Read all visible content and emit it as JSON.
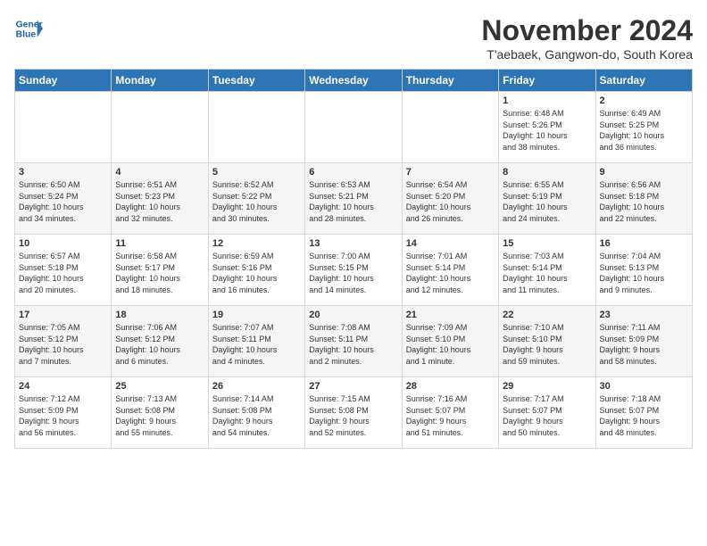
{
  "header": {
    "logo_line1": "General",
    "logo_line2": "Blue",
    "month_title": "November 2024",
    "location": "T'aebaek, Gangwon-do, South Korea"
  },
  "days_of_week": [
    "Sunday",
    "Monday",
    "Tuesday",
    "Wednesday",
    "Thursday",
    "Friday",
    "Saturday"
  ],
  "weeks": [
    [
      {
        "day": "",
        "info": ""
      },
      {
        "day": "",
        "info": ""
      },
      {
        "day": "",
        "info": ""
      },
      {
        "day": "",
        "info": ""
      },
      {
        "day": "",
        "info": ""
      },
      {
        "day": "1",
        "info": "Sunrise: 6:48 AM\nSunset: 5:26 PM\nDaylight: 10 hours\nand 38 minutes."
      },
      {
        "day": "2",
        "info": "Sunrise: 6:49 AM\nSunset: 5:25 PM\nDaylight: 10 hours\nand 36 minutes."
      }
    ],
    [
      {
        "day": "3",
        "info": "Sunrise: 6:50 AM\nSunset: 5:24 PM\nDaylight: 10 hours\nand 34 minutes."
      },
      {
        "day": "4",
        "info": "Sunrise: 6:51 AM\nSunset: 5:23 PM\nDaylight: 10 hours\nand 32 minutes."
      },
      {
        "day": "5",
        "info": "Sunrise: 6:52 AM\nSunset: 5:22 PM\nDaylight: 10 hours\nand 30 minutes."
      },
      {
        "day": "6",
        "info": "Sunrise: 6:53 AM\nSunset: 5:21 PM\nDaylight: 10 hours\nand 28 minutes."
      },
      {
        "day": "7",
        "info": "Sunrise: 6:54 AM\nSunset: 5:20 PM\nDaylight: 10 hours\nand 26 minutes."
      },
      {
        "day": "8",
        "info": "Sunrise: 6:55 AM\nSunset: 5:19 PM\nDaylight: 10 hours\nand 24 minutes."
      },
      {
        "day": "9",
        "info": "Sunrise: 6:56 AM\nSunset: 5:18 PM\nDaylight: 10 hours\nand 22 minutes."
      }
    ],
    [
      {
        "day": "10",
        "info": "Sunrise: 6:57 AM\nSunset: 5:18 PM\nDaylight: 10 hours\nand 20 minutes."
      },
      {
        "day": "11",
        "info": "Sunrise: 6:58 AM\nSunset: 5:17 PM\nDaylight: 10 hours\nand 18 minutes."
      },
      {
        "day": "12",
        "info": "Sunrise: 6:59 AM\nSunset: 5:16 PM\nDaylight: 10 hours\nand 16 minutes."
      },
      {
        "day": "13",
        "info": "Sunrise: 7:00 AM\nSunset: 5:15 PM\nDaylight: 10 hours\nand 14 minutes."
      },
      {
        "day": "14",
        "info": "Sunrise: 7:01 AM\nSunset: 5:14 PM\nDaylight: 10 hours\nand 12 minutes."
      },
      {
        "day": "15",
        "info": "Sunrise: 7:03 AM\nSunset: 5:14 PM\nDaylight: 10 hours\nand 11 minutes."
      },
      {
        "day": "16",
        "info": "Sunrise: 7:04 AM\nSunset: 5:13 PM\nDaylight: 10 hours\nand 9 minutes."
      }
    ],
    [
      {
        "day": "17",
        "info": "Sunrise: 7:05 AM\nSunset: 5:12 PM\nDaylight: 10 hours\nand 7 minutes."
      },
      {
        "day": "18",
        "info": "Sunrise: 7:06 AM\nSunset: 5:12 PM\nDaylight: 10 hours\nand 6 minutes."
      },
      {
        "day": "19",
        "info": "Sunrise: 7:07 AM\nSunset: 5:11 PM\nDaylight: 10 hours\nand 4 minutes."
      },
      {
        "day": "20",
        "info": "Sunrise: 7:08 AM\nSunset: 5:11 PM\nDaylight: 10 hours\nand 2 minutes."
      },
      {
        "day": "21",
        "info": "Sunrise: 7:09 AM\nSunset: 5:10 PM\nDaylight: 10 hours\nand 1 minute."
      },
      {
        "day": "22",
        "info": "Sunrise: 7:10 AM\nSunset: 5:10 PM\nDaylight: 9 hours\nand 59 minutes."
      },
      {
        "day": "23",
        "info": "Sunrise: 7:11 AM\nSunset: 5:09 PM\nDaylight: 9 hours\nand 58 minutes."
      }
    ],
    [
      {
        "day": "24",
        "info": "Sunrise: 7:12 AM\nSunset: 5:09 PM\nDaylight: 9 hours\nand 56 minutes."
      },
      {
        "day": "25",
        "info": "Sunrise: 7:13 AM\nSunset: 5:08 PM\nDaylight: 9 hours\nand 55 minutes."
      },
      {
        "day": "26",
        "info": "Sunrise: 7:14 AM\nSunset: 5:08 PM\nDaylight: 9 hours\nand 54 minutes."
      },
      {
        "day": "27",
        "info": "Sunrise: 7:15 AM\nSunset: 5:08 PM\nDaylight: 9 hours\nand 52 minutes."
      },
      {
        "day": "28",
        "info": "Sunrise: 7:16 AM\nSunset: 5:07 PM\nDaylight: 9 hours\nand 51 minutes."
      },
      {
        "day": "29",
        "info": "Sunrise: 7:17 AM\nSunset: 5:07 PM\nDaylight: 9 hours\nand 50 minutes."
      },
      {
        "day": "30",
        "info": "Sunrise: 7:18 AM\nSunset: 5:07 PM\nDaylight: 9 hours\nand 48 minutes."
      }
    ]
  ]
}
